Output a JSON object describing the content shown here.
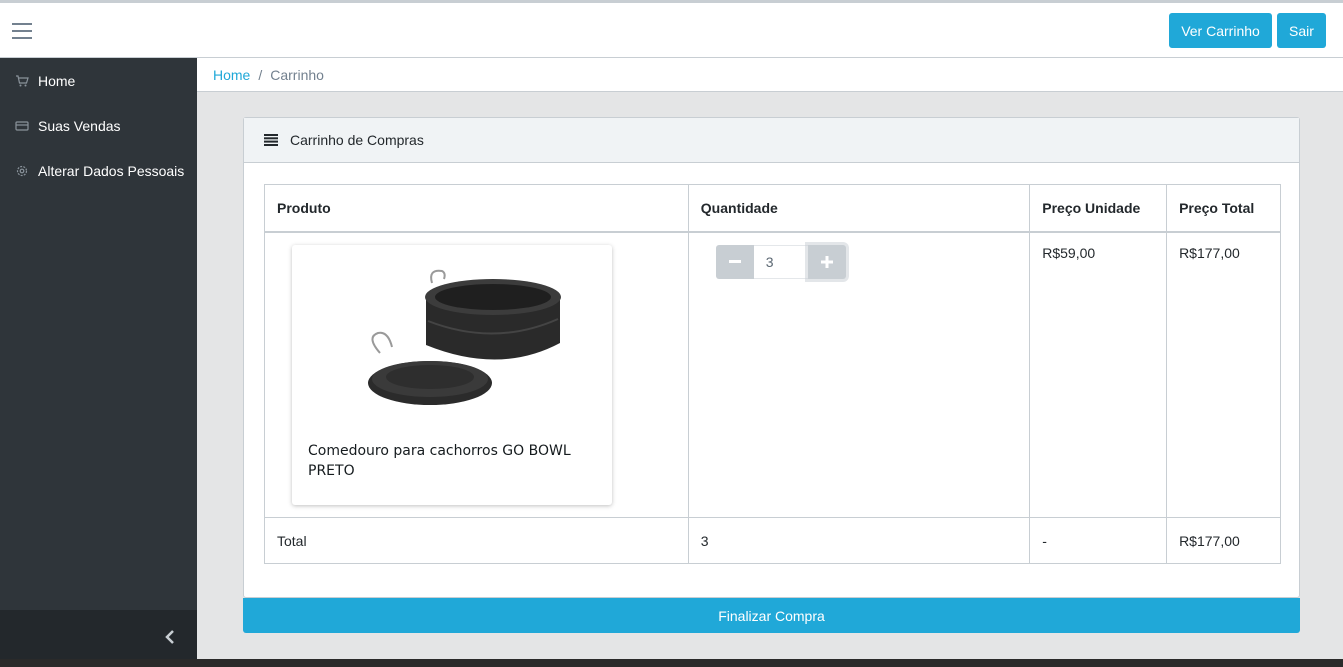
{
  "header": {
    "cart_button": "Ver Carrinho",
    "exit_button": "Sair"
  },
  "sidebar": {
    "items": [
      {
        "label": "Home",
        "icon": "basket-icon"
      },
      {
        "label": "Suas Vendas",
        "icon": "credit-card-icon"
      },
      {
        "label": "Alterar Dados Pessoais",
        "icon": "gear-icon"
      }
    ]
  },
  "breadcrumb": {
    "home": "Home",
    "separator": "/",
    "current": "Carrinho"
  },
  "card": {
    "title": "Carrinho de Compras",
    "columns": [
      "Produto",
      "Quantidade",
      "Preço Unidade",
      "Preço Total"
    ],
    "item": {
      "name": "Comedouro para cachorros GO BOWL PRETO",
      "quantity": "3",
      "unit_price": "R$59,00",
      "total_price": "R$177,00"
    },
    "totals": {
      "label": "Total",
      "quantity": "3",
      "unit_price": "-",
      "total_price": "R$177,00"
    },
    "finalize_button": "Finalizar Compra"
  },
  "colors": {
    "primary": "#20a8d8",
    "sidebar": "#2f353a",
    "border": "#c8ced3"
  }
}
